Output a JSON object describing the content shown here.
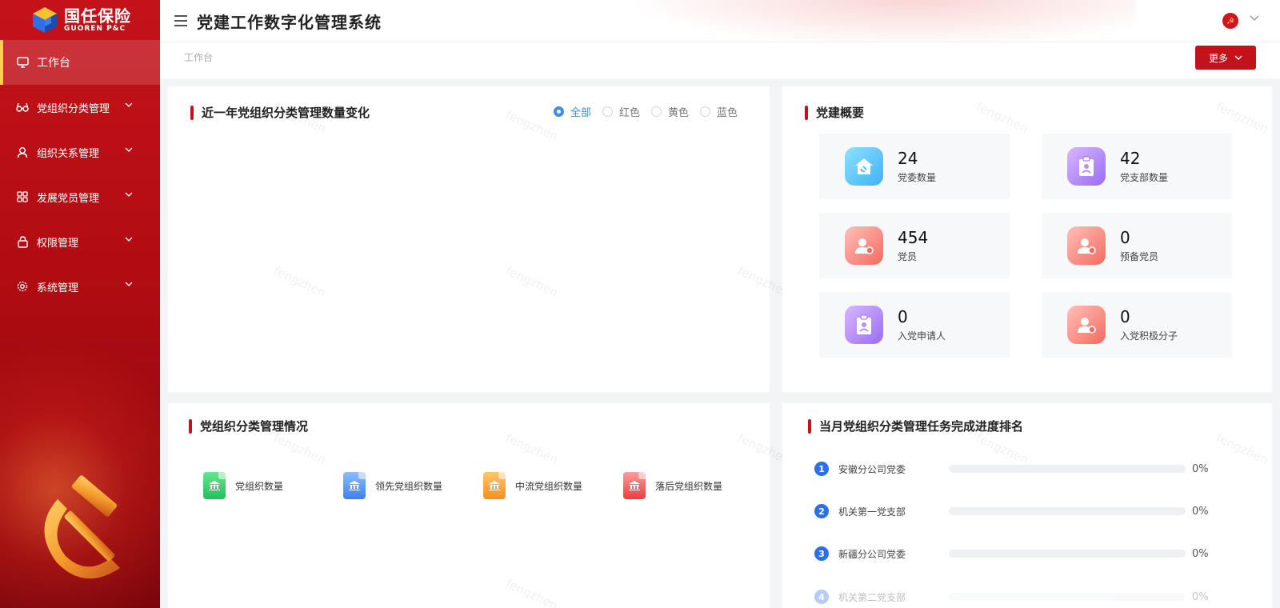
{
  "brand": {
    "name_cn": "国任保险",
    "name_en": "GUOREN P&C"
  },
  "header": {
    "title": "党建工作数字化管理系统"
  },
  "sidebar": {
    "items": [
      {
        "label": "工作台",
        "icon": "monitor-icon",
        "active": true
      },
      {
        "label": "党组织分类管理",
        "icon": "glasses-icon"
      },
      {
        "label": "组织关系管理",
        "icon": "user-icon"
      },
      {
        "label": "发展党员管理",
        "icon": "grid-icon"
      },
      {
        "label": "权限管理",
        "icon": "lock-icon"
      },
      {
        "label": "系统管理",
        "icon": "gear-icon"
      }
    ]
  },
  "breadcrumb": "工作台",
  "more_button": "更多",
  "trend_card": {
    "title": "近一年党组织分类管理数量变化",
    "filters": [
      "全部",
      "红色",
      "黄色",
      "蓝色"
    ],
    "selected_filter": "全部"
  },
  "overview_card": {
    "title": "党建概要",
    "stats": [
      {
        "value": "24",
        "label": "党委数量",
        "icon": "party-house-icon"
      },
      {
        "value": "42",
        "label": "党支部数量",
        "icon": "clipboard-icon"
      },
      {
        "value": "454",
        "label": "党员",
        "icon": "member-icon"
      },
      {
        "value": "0",
        "label": "预备党员",
        "icon": "member-icon"
      },
      {
        "value": "0",
        "label": "入党申请人",
        "icon": "clipboard-icon"
      },
      {
        "value": "0",
        "label": "入党积极分子",
        "icon": "member-icon"
      }
    ]
  },
  "org_card": {
    "title": "党组织分类管理情况",
    "items": [
      {
        "label": "党组织数量",
        "color": "#1fc15a"
      },
      {
        "label": "领先党组织数量",
        "color": "#3b82f0"
      },
      {
        "label": "中流党组织数量",
        "color": "#f68f1e"
      },
      {
        "label": "落后党组织数量",
        "color": "#ec3d3d"
      }
    ]
  },
  "rank_card": {
    "title": "当月党组织分类管理任务完成进度排名",
    "rows": [
      {
        "rank": "1",
        "name": "安徽分公司党委",
        "percent": "0%",
        "progress": 0
      },
      {
        "rank": "2",
        "name": "机关第一党支部",
        "percent": "0%",
        "progress": 0
      },
      {
        "rank": "3",
        "name": "新疆分公司党委",
        "percent": "0%",
        "progress": 0
      },
      {
        "rank": "4",
        "name": "机关第二党支部",
        "percent": "0%",
        "progress": 0
      }
    ]
  },
  "watermark": "fengzhen",
  "colors": {
    "primary": "#c4121a",
    "accent": "#3a8ef0",
    "rank_blue": "#2a6ff0"
  }
}
